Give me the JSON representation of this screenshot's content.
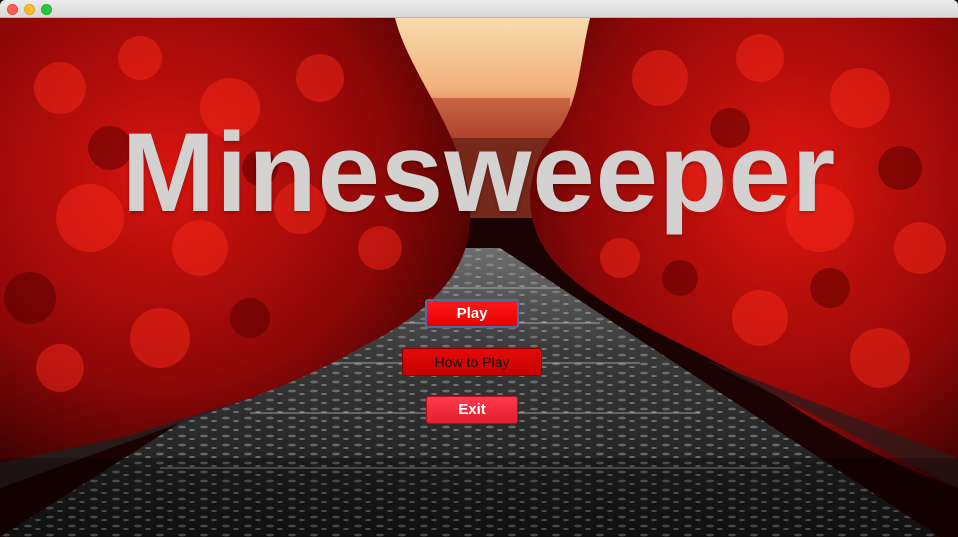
{
  "window": {
    "controls": [
      "close",
      "minimize",
      "zoom"
    ]
  },
  "title": "Minesweeper",
  "menu": {
    "play_label": "Play",
    "how_to_play_label": "How to Play",
    "exit_label": "Exit"
  },
  "colors": {
    "title_text": "#d4d1d1",
    "play_button": "#ff1a1a",
    "how_to_play_button": "#e60a0a",
    "exit_button": "#ff3a4a",
    "foliage": "#b00a0a"
  }
}
